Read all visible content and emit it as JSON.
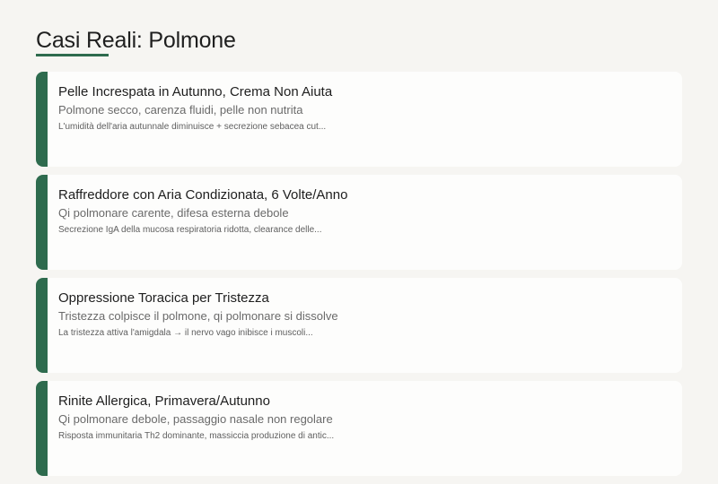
{
  "page": {
    "title": "Casi Reali: Polmone"
  },
  "colors": {
    "accent": "#2e6b4e",
    "background": "#f6f5f2",
    "card": "#fdfdfc"
  },
  "cases": [
    {
      "title": "Pelle Increspata in Autunno, Crema Non Aiuta",
      "subtitle": "Polmone secco, carenza fluidi, pelle non nutrita",
      "description": "L'umidità dell'aria autunnale diminuisce + secrezione sebacea cut..."
    },
    {
      "title": "Raffreddore con Aria Condizionata, 6 Volte/Anno",
      "subtitle": "Qi polmonare carente, difesa esterna debole",
      "description": "Secrezione IgA della mucosa respiratoria ridotta, clearance delle..."
    },
    {
      "title": "Oppressione Toracica per Tristezza",
      "subtitle": "Tristezza colpisce il polmone, qi polmonare si dissolve",
      "description": "La tristezza attiva l'amigdala → il nervo vago inibisce i muscoli..."
    },
    {
      "title": "Rinite Allergica, Primavera/Autunno",
      "subtitle": "Qi polmonare debole, passaggio nasale non regolare",
      "description": "Risposta immunitaria Th2 dominante, massiccia produzione di antic..."
    }
  ]
}
